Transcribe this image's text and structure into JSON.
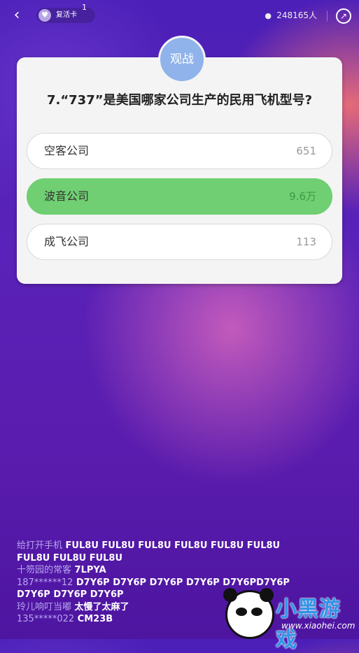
{
  "header": {
    "back_icon": "chevron-left-icon",
    "revive_card_label": "复活卡",
    "revive_card_count": "1",
    "viewer_count": "248165人",
    "share_icon": "share-icon"
  },
  "quiz": {
    "watch_label": "观战",
    "question": "7.“737”是美国哪家公司生产的民用飞机型号?",
    "options": [
      {
        "label": "空客公司",
        "count": "651",
        "correct": false
      },
      {
        "label": "波音公司",
        "count": "9.6万",
        "correct": true
      },
      {
        "label": "成飞公司",
        "count": "113",
        "correct": false
      }
    ],
    "correct_color": "#6fcf72"
  },
  "chat": [
    {
      "name": "给打开手机",
      "message": "FUL8U FUL8U FUL8U FUL8U FUL8U FUL8U FUL8U FUL8U FUL8U"
    },
    {
      "name": "十笏园的常客",
      "message": "7LPYA"
    },
    {
      "name": "187******12",
      "message": "D7Y6P D7Y6P D7Y6P D7Y6P D7Y6PD7Y6P D7Y6P D7Y6P D7Y6P"
    },
    {
      "name": "玲儿响叮当嘟",
      "message": "太慢了太麻了"
    },
    {
      "name": "135*****022",
      "message": "CM23B"
    }
  ],
  "watermark": {
    "text": "小黑游戏",
    "url": "www.xiaohei.com"
  }
}
